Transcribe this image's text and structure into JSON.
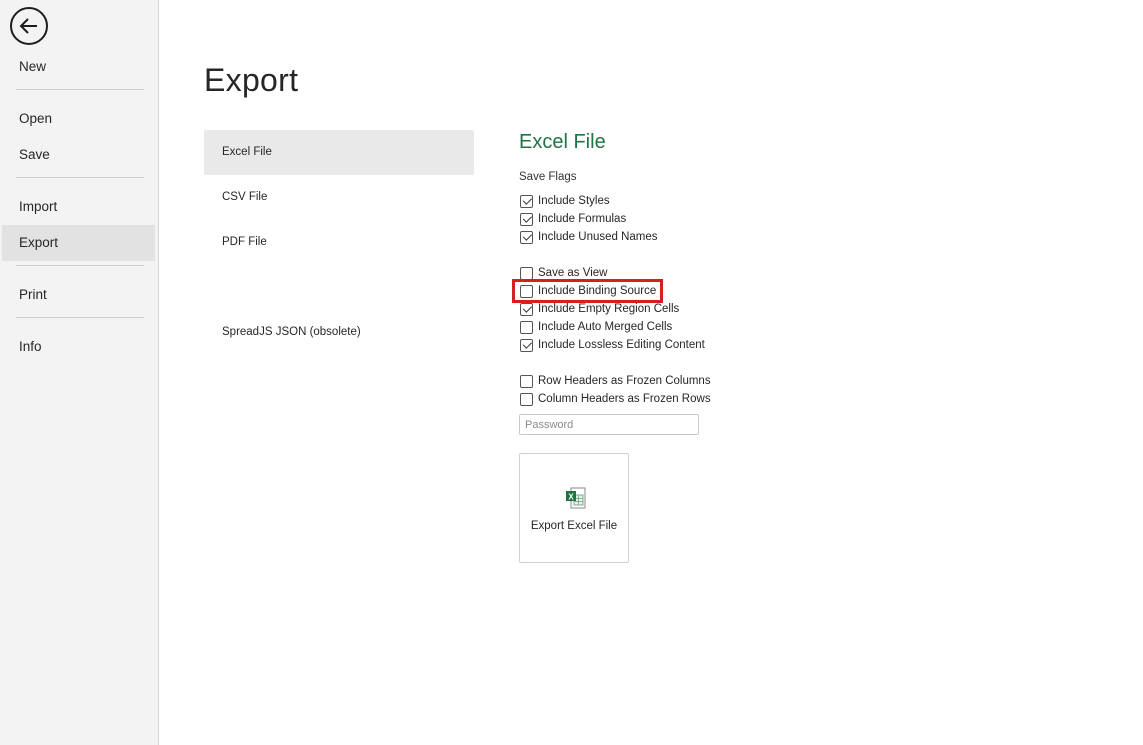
{
  "sidebar": {
    "back_icon": "arrow-left-icon",
    "items": [
      {
        "label": "New"
      },
      {
        "label": "Open"
      },
      {
        "label": "Save"
      },
      {
        "label": "Import"
      },
      {
        "label": "Export",
        "active": true
      },
      {
        "label": "Print"
      },
      {
        "label": "Info"
      }
    ]
  },
  "page": {
    "title": "Export"
  },
  "export_types": [
    {
      "label": "Excel File",
      "active": true
    },
    {
      "label": "CSV File"
    },
    {
      "label": "PDF File"
    },
    {
      "label": "SpreadJS JSON (obsolete)"
    }
  ],
  "excel_panel": {
    "title": "Excel File",
    "flags_label": "Save Flags",
    "options": [
      {
        "label": "Include Styles",
        "checked": true
      },
      {
        "label": "Include Formulas",
        "checked": true
      },
      {
        "label": "Include Unused Names",
        "checked": true
      },
      {
        "label": "Save as View",
        "checked": false
      },
      {
        "label": "Include Binding Source",
        "checked": false,
        "highlighted": true
      },
      {
        "label": "Include Empty Region Cells",
        "checked": true
      },
      {
        "label": "Include Auto Merged Cells",
        "checked": false
      },
      {
        "label": "Include Lossless Editing Content",
        "checked": true
      },
      {
        "label": "Row Headers as Frozen Columns",
        "checked": false
      },
      {
        "label": "Column Headers as Frozen Rows",
        "checked": false
      }
    ],
    "password": {
      "value": "",
      "placeholder": "Password"
    },
    "export_button": {
      "label": "Export Excel File",
      "icon": "excel-file-icon"
    }
  },
  "colors": {
    "accent": "#217346",
    "highlight": "#d32020",
    "sidebar_bg": "#f3f3f3"
  }
}
